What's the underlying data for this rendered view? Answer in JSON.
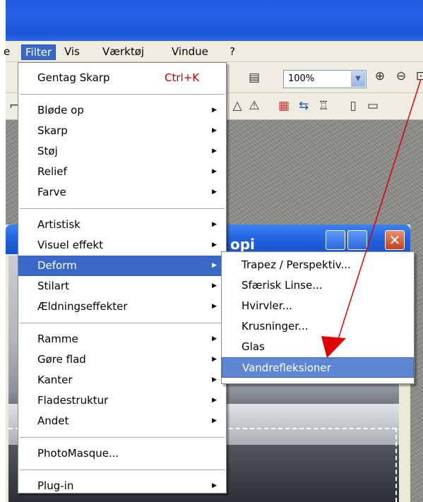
{
  "menubar": {
    "items": [
      {
        "label": "e"
      },
      {
        "label": "Filter"
      },
      {
        "label": "Vis"
      },
      {
        "label": "Værktøj"
      },
      {
        "label": "Vindue"
      },
      {
        "label": "?"
      }
    ]
  },
  "toolbar": {
    "zoom_value": "100%"
  },
  "child_window": {
    "title": "opi",
    "close_glyph": "✕"
  },
  "filter_menu": {
    "repeat": {
      "label": "Gentag Skarp",
      "shortcut": "Ctrl+K"
    },
    "group1": [
      "Bløde op",
      "Skarp",
      "Støj",
      "Relief",
      "Farve"
    ],
    "group2": [
      "Artistisk",
      "Visuel effekt",
      "Deform",
      "Stilart",
      "Ældningseffekter"
    ],
    "group3": [
      "Ramme",
      "Gøre flad",
      "Kanter",
      "Fladestruktur",
      "Andet"
    ],
    "photomasque": "PhotoMasque...",
    "plugin": "Plug-in"
  },
  "deform_menu": {
    "items": [
      "Trapez / Perspektiv...",
      "Sfærisk Linse...",
      "Hvirvler...",
      "Krusninger...",
      "Glas",
      "Vandrefleksioner"
    ]
  },
  "annotation": {
    "color": "#e00000"
  }
}
